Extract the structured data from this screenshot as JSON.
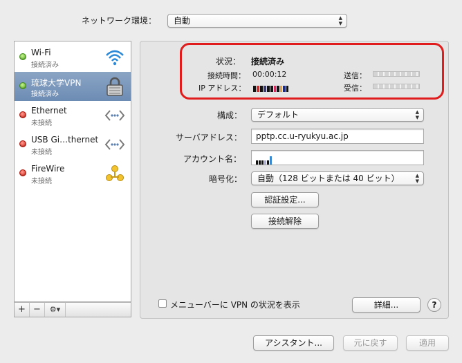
{
  "location": {
    "label": "ネットワーク環境：",
    "value": "自動"
  },
  "services": [
    {
      "name": "Wi-Fi",
      "status": "接続済み",
      "state": "green",
      "icon": "wifi-icon",
      "selected": false
    },
    {
      "name": "琉球大学VPN",
      "status": "接続済み",
      "state": "green",
      "icon": "lock-icon",
      "selected": true
    },
    {
      "name": "Ethernet",
      "status": "未接続",
      "state": "red",
      "icon": "ethernet-icon",
      "selected": false
    },
    {
      "name": "USB Gi…thernet",
      "status": "未接続",
      "state": "red",
      "icon": "ethernet-icon",
      "selected": false
    },
    {
      "name": "FireWire",
      "status": "未接続",
      "state": "red",
      "icon": "firewire-icon",
      "selected": false
    }
  ],
  "toolbar": {
    "add": "+",
    "remove": "−",
    "gear": "⚙▾"
  },
  "status": {
    "status_label": "状況：",
    "status_value": "接続済み",
    "time_label": "接続時間：",
    "time_value": "00:00:12",
    "ip_label": "IP アドレス：",
    "send_label": "送信：",
    "recv_label": "受信："
  },
  "config": {
    "config_label": "構成：",
    "config_value": "デフォルト",
    "server_label": "サーバアドレス：",
    "server_value": "pptp.cc.u-ryukyu.ac.jp",
    "account_label": "アカウント名：",
    "encryption_label": "暗号化：",
    "encryption_value": "自動（128 ビットまたは 40 ビット）",
    "auth_button": "認証設定...",
    "disconnect_button": "接続解除"
  },
  "bottom": {
    "show_vpn_label": "メニューバーに VPN の状況を表示",
    "details_button": "詳細...",
    "help_button": "?",
    "assistant_button": "アシスタント...",
    "revert_button": "元に戻す",
    "apply_button": "適用"
  },
  "colors": {
    "highlight": "#e01c1c",
    "selection": "#7b97bc"
  }
}
